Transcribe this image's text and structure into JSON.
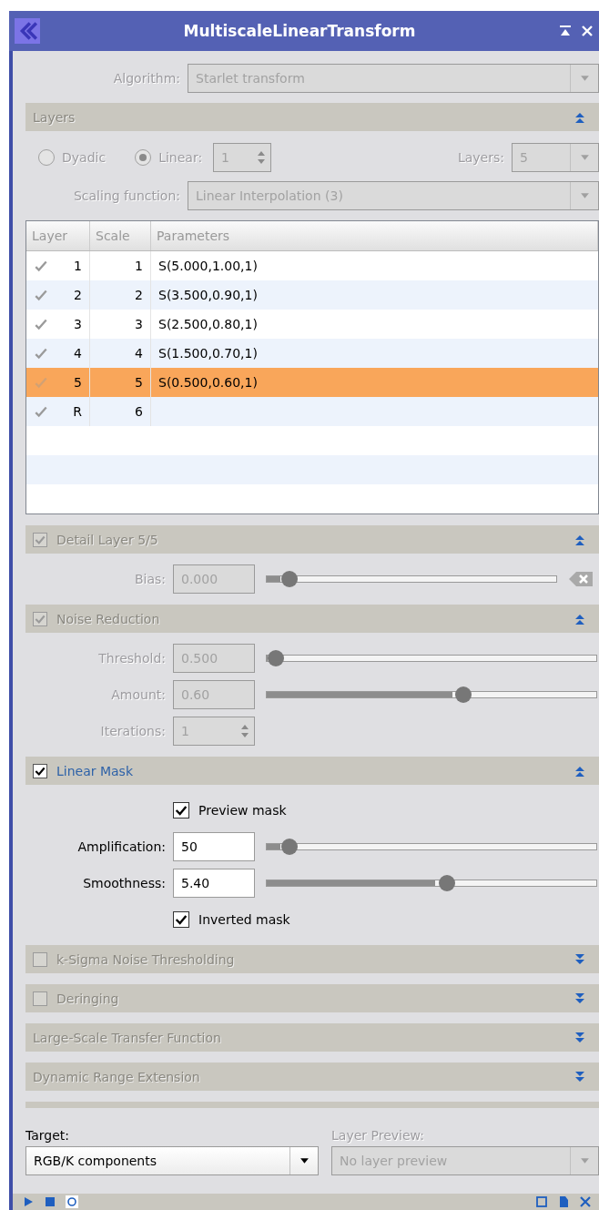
{
  "window": {
    "title": "MultiscaleLinearTransform"
  },
  "algorithm": {
    "label": "Algorithm:",
    "value": "Starlet transform",
    "disabled": true
  },
  "sections": [
    {
      "kind": "layers",
      "title": "Layers",
      "expanded": true,
      "disabled": true,
      "dyadic": {
        "label": "Dyadic",
        "selected": false
      },
      "linear": {
        "label": "Linear:",
        "selected": true,
        "value": "1"
      },
      "layer_count": {
        "label": "Layers:",
        "value": "5"
      },
      "scaling": {
        "label": "Scaling function:",
        "value": "Linear Interpolation (3)"
      },
      "table": {
        "columns": [
          "Layer",
          "Scale",
          "Parameters"
        ],
        "rows": [
          {
            "layer": "1",
            "scale": "1",
            "parameters": "S(5.000,1.00,1)",
            "checked": true,
            "selected": false
          },
          {
            "layer": "2",
            "scale": "2",
            "parameters": "S(3.500,0.90,1)",
            "checked": true,
            "selected": false
          },
          {
            "layer": "3",
            "scale": "3",
            "parameters": "S(2.500,0.80,1)",
            "checked": true,
            "selected": false
          },
          {
            "layer": "4",
            "scale": "4",
            "parameters": "S(1.500,0.70,1)",
            "checked": true,
            "selected": false
          },
          {
            "layer": "5",
            "scale": "5",
            "parameters": "S(0.500,0.60,1)",
            "checked": true,
            "selected": true
          },
          {
            "layer": "R",
            "scale": "6",
            "checked": true,
            "selected": false
          }
        ]
      }
    },
    {
      "kind": "params",
      "title": "Detail Layer 5/5",
      "checked": true,
      "expanded": true,
      "disabled": true,
      "rows": [
        {
          "kind": "slider",
          "label": "Bias:",
          "value": "0.000",
          "level": 0.08,
          "disabled": true,
          "reset": true
        }
      ]
    },
    {
      "kind": "params",
      "title": "Noise Reduction",
      "checked": true,
      "expanded": true,
      "disabled": true,
      "rows": [
        {
          "kind": "slider",
          "label": "Threshold:",
          "value": "0.500",
          "level": 0.03,
          "disabled": true
        },
        {
          "kind": "slider",
          "label": "Amount:",
          "value": "0.60",
          "level": 0.59,
          "disabled": true
        },
        {
          "kind": "spin",
          "label": "Iterations:",
          "value": "1",
          "disabled": true
        }
      ]
    },
    {
      "kind": "params",
      "title": "Linear Mask",
      "checked": true,
      "expanded": true,
      "disabled": false,
      "rows": [
        {
          "kind": "checkbox",
          "label": "Preview mask",
          "checked": true
        },
        {
          "kind": "slider",
          "label": "Amplification:",
          "value": "50",
          "level": 0.07,
          "disabled": false
        },
        {
          "kind": "slider",
          "label": "Smoothness:",
          "value": "5.40",
          "level": 0.54,
          "disabled": false
        },
        {
          "kind": "checkbox",
          "label": "Inverted mask",
          "checked": true
        }
      ]
    },
    {
      "title": "k-Sigma Noise Thresholding",
      "checked": false,
      "expanded": false,
      "disabled": true
    },
    {
      "title": "Deringing",
      "checked": false,
      "expanded": false,
      "disabled": true
    },
    {
      "title": "Large-Scale Transfer Function",
      "expanded": false,
      "disabled": true
    },
    {
      "title": "Dynamic Range Extension",
      "expanded": false,
      "disabled": true
    }
  ],
  "target": {
    "label": "Target:",
    "value": "RGB/K components"
  },
  "layer_preview": {
    "label": "Layer Preview:",
    "value": "No layer preview",
    "disabled": true
  }
}
